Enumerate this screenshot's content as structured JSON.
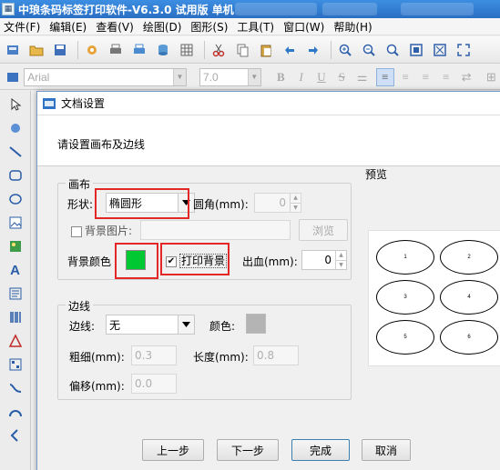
{
  "app": {
    "title": "中琅条码标签打印软件-V6.3.0 试用版 单机"
  },
  "menu": [
    "文件(F)",
    "编辑(E)",
    "查看(V)",
    "绘图(D)",
    "图形(S)",
    "工具(T)",
    "窗口(W)",
    "帮助(H)"
  ],
  "format_bar": {
    "font_name": "Arial",
    "font_size": "7.0",
    "bold": "B",
    "italic": "I",
    "underline": "U",
    "strike": "S"
  },
  "left_tools": {
    "text_tool": "A"
  },
  "dialog": {
    "title": "文档设置",
    "heading": "请设置画布及边线",
    "canvas_group": {
      "title": "画布",
      "shape_label": "形状:",
      "shape_value": "椭圆形",
      "corner_label": "圆角(mm):",
      "corner_value": "0",
      "bg_image_label": "背景图片:",
      "browse_label": "浏览",
      "bg_color_label": "背景颜色",
      "bg_color": "#00c832",
      "print_bg_label": "打印背景",
      "print_bg_checked": true,
      "bleed_label": "出血(mm):",
      "bleed_value": "0"
    },
    "border_group": {
      "title": "边线",
      "border_label": "边线:",
      "border_value": "无",
      "color_label": "颜色:",
      "color_value": "#b4b4b4",
      "thickness_label": "粗细(mm):",
      "thickness_value": "0.3",
      "length_label": "长度(mm):",
      "length_value": "0.8",
      "offset_label": "偏移(mm):",
      "offset_value": "0.0"
    },
    "preview": {
      "title": "预览",
      "labels": [
        "1",
        "2",
        "3",
        "4",
        "5",
        "6"
      ]
    },
    "buttons": {
      "prev": "上一步",
      "next": "下一步",
      "finish": "完成",
      "cancel": "取消"
    }
  }
}
